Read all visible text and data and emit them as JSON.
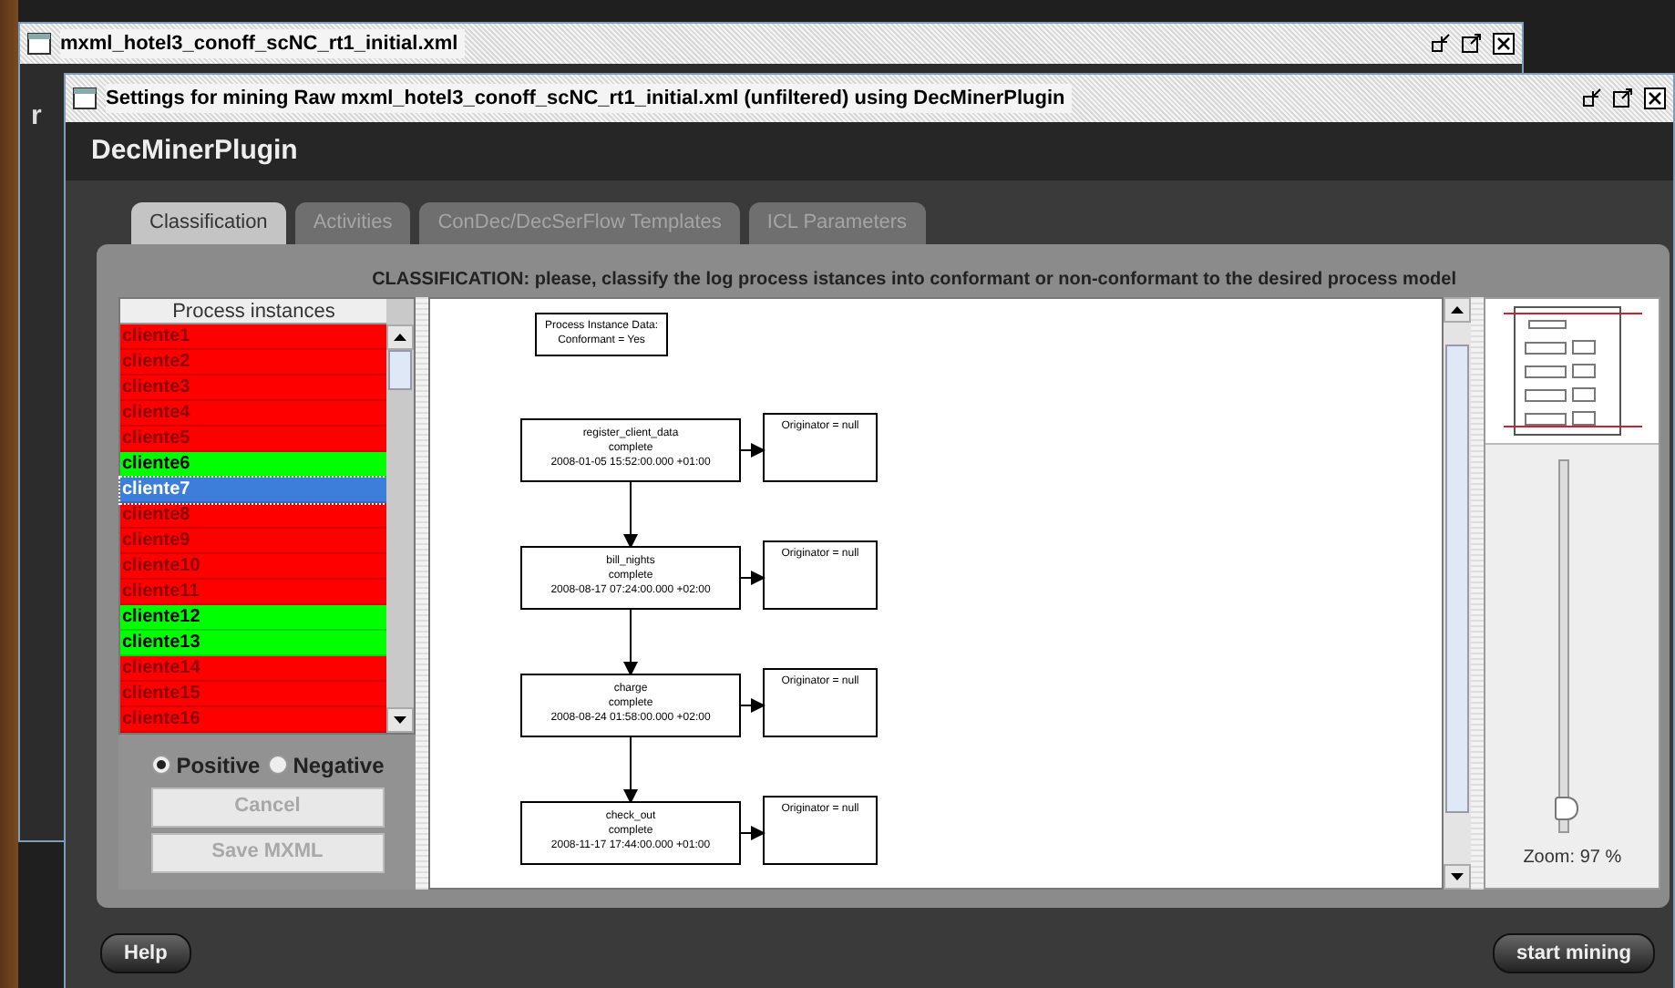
{
  "back_window": {
    "title": "mxml_hotel3_conoff_scNC_rt1_initial.xml",
    "fragment": "r"
  },
  "window": {
    "title": "Settings for mining Raw mxml_hotel3_conoff_scNC_rt1_initial.xml (unfiltered) using DecMinerPlugin"
  },
  "plugin_title": "DecMinerPlugin",
  "tabs": [
    {
      "label": "Classification",
      "selected": true
    },
    {
      "label": "Activities",
      "selected": false
    },
    {
      "label": "ConDec/DecSerFlow Templates",
      "selected": false
    },
    {
      "label": "ICL Parameters",
      "selected": false
    }
  ],
  "instruction": "CLASSIFICATION: please, classify the log process istances into conformant or non-conformant to the desired process model",
  "instances": {
    "header": "Process instances",
    "items": [
      {
        "label": "cliente1",
        "color": "#ff0000",
        "selected": false
      },
      {
        "label": "cliente2",
        "color": "#ff0000",
        "selected": false
      },
      {
        "label": "cliente3",
        "color": "#ff0000",
        "selected": false
      },
      {
        "label": "cliente4",
        "color": "#ff0000",
        "selected": false
      },
      {
        "label": "cliente5",
        "color": "#ff0000",
        "selected": false
      },
      {
        "label": "cliente6",
        "color": "#00ff00",
        "selected": false
      },
      {
        "label": "cliente7",
        "color": "#3d7edb",
        "selected": true
      },
      {
        "label": "cliente8",
        "color": "#ff0000",
        "selected": false
      },
      {
        "label": "cliente9",
        "color": "#ff0000",
        "selected": false
      },
      {
        "label": "cliente10",
        "color": "#ff0000",
        "selected": false
      },
      {
        "label": "cliente11",
        "color": "#ff0000",
        "selected": false
      },
      {
        "label": "cliente12",
        "color": "#00ff00",
        "selected": false
      },
      {
        "label": "cliente13",
        "color": "#00ff00",
        "selected": false
      },
      {
        "label": "cliente14",
        "color": "#ff0000",
        "selected": false
      },
      {
        "label": "cliente15",
        "color": "#ff0000",
        "selected": false
      },
      {
        "label": "cliente16",
        "color": "#ff0000",
        "selected": false
      }
    ]
  },
  "radios": [
    {
      "label": "Positive",
      "selected": true
    },
    {
      "label": "Negative",
      "selected": false
    }
  ],
  "buttons": [
    {
      "label": "Cancel",
      "disabled": true
    },
    {
      "label": "Save MXML",
      "disabled": true
    }
  ],
  "diagram": {
    "info": [
      "Process Instance Data:",
      "Conformant = Yes"
    ],
    "events": [
      {
        "name": "register_client_data",
        "status": "complete",
        "timestamp": "2008-01-05  15:52:00.000  +01:00",
        "originator": "Originator = null"
      },
      {
        "name": "bill_nights",
        "status": "complete",
        "timestamp": "2008-08-17  07:24:00.000  +02:00",
        "originator": "Originator = null"
      },
      {
        "name": "charge",
        "status": "complete",
        "timestamp": "2008-08-24  01:58:00.000  +02:00",
        "originator": "Originator = null"
      },
      {
        "name": "check_out",
        "status": "complete",
        "timestamp": "2008-11-17  17:44:00.000  +01:00",
        "originator": "Originator = null"
      }
    ]
  },
  "zoom": {
    "level": 0.03,
    "reading": "Zoom: 97 %"
  },
  "footer": {
    "help": "Help",
    "start": "start mining"
  }
}
